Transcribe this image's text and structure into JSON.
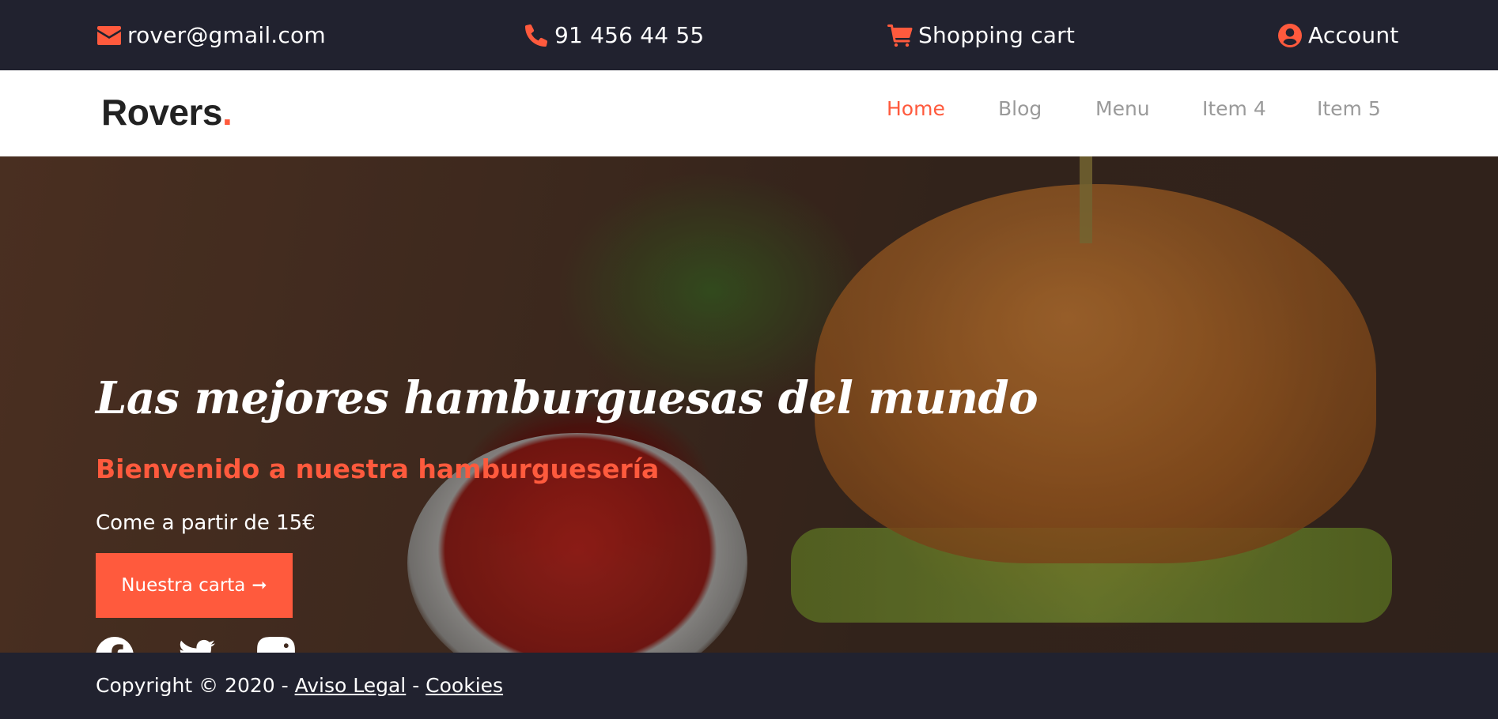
{
  "topbar": {
    "email": "rover@gmail.com",
    "phone": "91 456 44 55",
    "cart": "Shopping cart",
    "account": "Account"
  },
  "brand": {
    "name": "Rovers",
    "dot": "."
  },
  "nav": {
    "items": [
      {
        "label": "Home",
        "active": true
      },
      {
        "label": "Blog",
        "active": false
      },
      {
        "label": "Menu",
        "active": false
      },
      {
        "label": "Item 4",
        "active": false
      },
      {
        "label": "Item 5",
        "active": false
      }
    ]
  },
  "hero": {
    "title": "Las mejores hamburguesas del mundo",
    "subtitle": "Bienvenido a nuestra hamburguesería",
    "price_text": "Come a partir de 15€",
    "cta_label": "Nuestra carta",
    "cta_arrow": "➞"
  },
  "socials": [
    "facebook-icon",
    "twitter-icon",
    "instagram-icon"
  ],
  "footer": {
    "copyright": "Copyright © 2020 - ",
    "legal_link": "Aviso Legal",
    "separator": " - ",
    "cookies_link": "Cookies"
  },
  "colors": {
    "accent": "#ff5a3d",
    "dark": "#21222f",
    "nav_text": "#9a9a9a"
  }
}
